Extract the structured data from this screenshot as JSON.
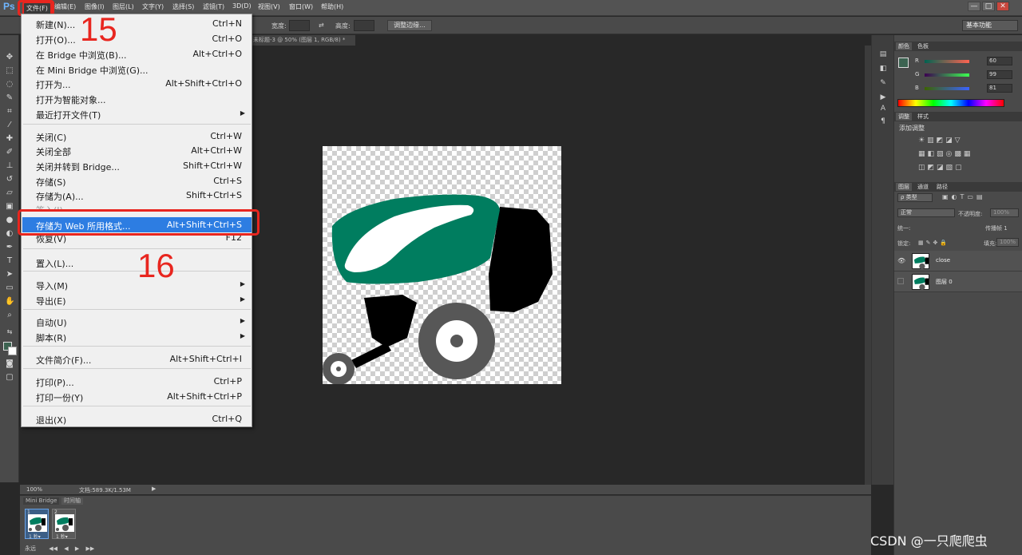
{
  "app": {
    "logo": "Ps",
    "menus": [
      "文件(F)",
      "编辑(E)",
      "图像(I)",
      "图层(L)",
      "文字(Y)",
      "选择(S)",
      "滤镜(T)",
      "3D(D)",
      "视图(V)",
      "窗口(W)",
      "帮助(H)"
    ],
    "window_buttons": [
      "—",
      "□",
      "✕"
    ]
  },
  "options_bar": {
    "width_label": "宽度:",
    "height_label": "高度:",
    "refine_edge": "调整边缘...",
    "workspace": "基本功能"
  },
  "document": {
    "tab_title": "未标题-3 @ 50% (图层 1, RGB/8) *",
    "zoom": "100%",
    "doc_info": "文档:589.3K/1.53M"
  },
  "file_menu": {
    "items": [
      {
        "label": "新建(N)...",
        "shortcut": "Ctrl+N"
      },
      {
        "label": "打开(O)...",
        "shortcut": "Ctrl+O"
      },
      {
        "label": "在 Bridge 中浏览(B)...",
        "shortcut": "Alt+Ctrl+O"
      },
      {
        "label": "在 Mini Bridge 中浏览(G)...",
        "shortcut": ""
      },
      {
        "label": "打开为...",
        "shortcut": "Alt+Shift+Ctrl+O"
      },
      {
        "label": "打开为智能对象...",
        "shortcut": ""
      },
      {
        "label": "最近打开文件(T)",
        "shortcut": ""
      },
      {
        "label": "关闭(C)",
        "shortcut": "Ctrl+W"
      },
      {
        "label": "关闭全部",
        "shortcut": "Alt+Ctrl+W"
      },
      {
        "label": "关闭并转到 Bridge...",
        "shortcut": "Shift+Ctrl+W"
      },
      {
        "label": "存储(S)",
        "shortcut": "Ctrl+S"
      },
      {
        "label": "存储为(A)...",
        "shortcut": "Shift+Ctrl+S"
      },
      {
        "label": "签入(I)...",
        "shortcut": ""
      },
      {
        "label": "存储为 Web 所用格式...",
        "shortcut": "Alt+Shift+Ctrl+S"
      },
      {
        "label": "恢复(V)",
        "shortcut": "F12"
      },
      {
        "label": "置入(L)...",
        "shortcut": ""
      },
      {
        "label": "导入(M)",
        "shortcut": ""
      },
      {
        "label": "导出(E)",
        "shortcut": ""
      },
      {
        "label": "自动(U)",
        "shortcut": ""
      },
      {
        "label": "脚本(R)",
        "shortcut": ""
      },
      {
        "label": "文件简介(F)...",
        "shortcut": "Alt+Shift+Ctrl+I"
      },
      {
        "label": "打印(P)...",
        "shortcut": "Ctrl+P"
      },
      {
        "label": "打印一份(Y)",
        "shortcut": "Alt+Shift+Ctrl+P"
      },
      {
        "label": "退出(X)",
        "shortcut": "Ctrl+Q"
      }
    ]
  },
  "annotations": {
    "step1": "15",
    "step2": "16"
  },
  "timeline": {
    "tabs": [
      "Mini Bridge",
      "时间轴"
    ],
    "frames": [
      {
        "num": "1",
        "time": "1 秒▾"
      },
      {
        "num": "2",
        "time": "1 秒▾"
      }
    ],
    "loop": "永远"
  },
  "color_panel": {
    "tabs": [
      "颜色",
      "色板"
    ],
    "channels": [
      {
        "name": "R",
        "value": "60"
      },
      {
        "name": "G",
        "value": "99"
      },
      {
        "name": "B",
        "value": "81"
      }
    ],
    "fg_color": "#3c6351"
  },
  "adjust_panel": {
    "tabs": [
      "调整",
      "样式"
    ],
    "title": "添加调整"
  },
  "layers_panel": {
    "tabs": [
      "图层",
      "通道",
      "路径"
    ],
    "filter": "ρ 类型",
    "blend_mode": "正常",
    "opacity_label": "不透明度:",
    "opacity_value": "100%",
    "unify_label": "统一:",
    "propagate": "传播帧 1",
    "lock_label": "锁定:",
    "fill_label": "填充:",
    "fill_value": "100%",
    "layers": [
      {
        "name": "close",
        "visible": "👁"
      },
      {
        "name": "图层 0",
        "visible": ""
      }
    ]
  },
  "watermark": "CSDN @一只爬爬虫",
  "colors": {
    "accent": "#e8261f",
    "highlight": "#2d7de2",
    "machine_green": "#007d5f"
  }
}
